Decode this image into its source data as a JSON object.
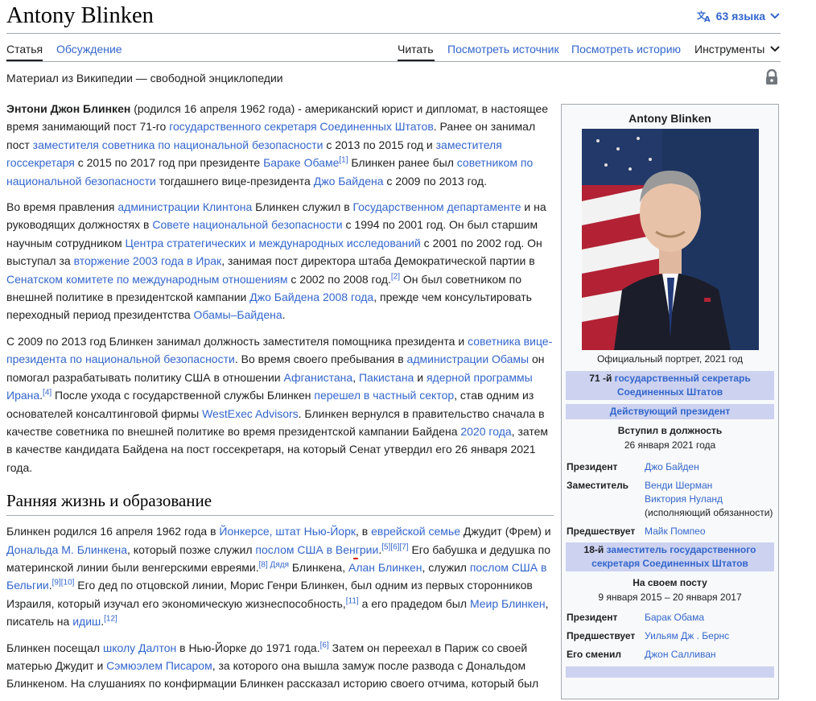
{
  "page": {
    "title": "Antony Blinken",
    "lang_label": "63 языка",
    "tabs": {
      "article": "Статья",
      "talk": "Обсуждение",
      "read": "Читать",
      "view_source": "Посмотреть источник",
      "history": "Посмотреть историю",
      "tools": "Инструменты"
    },
    "tagline": "Материал из Википедии — свободной энциклопедии"
  },
  "article": {
    "p1": {
      "bold": "Энтони Джон Блинкен",
      "t1": " (родился 16 апреля 1962 года) - американский юрист и дипломат, в настоящее время занимающий пост 71-го ",
      "l1": "государственного секретаря Соединенных Штатов",
      "t2": ". Ранее он занимал пост ",
      "l2": "заместителя советника по национальной безопасности",
      "t3": " с 2013 по 2015 год и ",
      "l3": "заместителя госсекретаря",
      "t4": " с 2015 по 2017 год при президенте ",
      "l4": "Бараке Обаме",
      "r1": "[1]",
      "t5": " Блинкен ранее был ",
      "l5": "советником по национальной безопасности",
      "t6": " тогдашнего вице-президента ",
      "l6": "Джо Байдена",
      "t7": " с 2009 по 2013 год."
    },
    "p2": {
      "t1": "Во время правления ",
      "l1": "администрации Клинтона",
      "t2": " Блинкен служил в ",
      "l2": "Государственном департаменте",
      "t3": " и на руководящих должностях в ",
      "l3": "Совете национальной безопасности",
      "t4": " с 1994 по 2001 год. Он был старшим научным сотрудником ",
      "l4": "Центра стратегических и международных исследований",
      "t5": " с 2001 по 2002 год. Он выступал за ",
      "l5": "вторжение 2003 года в Ирак",
      "t6": ", занимая пост директора штаба Демократической партии в ",
      "l6": "Сенатском комитете по международным отношениям",
      "t7": " с 2002 по 2008 год.",
      "r1": "[2]",
      "t8": " Он был советником по внешней политике в президентской кампании ",
      "l7": "Джо Байдена 2008 года",
      "t9": ", прежде чем консультировать переходный период президентства ",
      "l8": "Обамы–Байдена",
      "t10": "."
    },
    "p3": {
      "t1": "С 2009 по 2013 год Блинкен занимал должность заместителя помощника президента и ",
      "l1": "советника вице-президента по национальной безопасности",
      "t2": ". Во время своего пребывания в ",
      "l2": "администрации Обамы",
      "t3": " он помогал разрабатывать политику США в отношении ",
      "l3": "Афганистана",
      "t4": ", ",
      "l4": "Пакистана",
      "t5": " и ",
      "l5": "ядерной программы Ирана",
      "t6": ".",
      "r1": "[4]",
      "t7": " После ухода с государственной службы Блинкен ",
      "l6": "перешел в частный сектор",
      "t8": ", став одним из основателей консалтинговой фирмы ",
      "l7": "WestExec Advisors",
      "t9": ". Блинкен вернулся в правительство сначала в качестве советника по внешней политике во время президентской кампании Байдена ",
      "l8": "2020 года",
      "t10": ", затем в качестве кандидата Байдена на пост госсекретаря, на который Сенат утвердил его 26 января 2021 года."
    },
    "section_heading": "Ранняя жизнь и образование",
    "p4": {
      "t1": "Блинкен родился 16 апреля 1962 года в ",
      "l1": "Йонкерсе, штат Нью-Йорк",
      "t2": ", в ",
      "l2": "еврейской семье",
      "t3": " Джудит (Фрем) и ",
      "l3": "Дональда М. Блинкена",
      "t4": ", который позже служил ",
      "l4": "послом США в Венгрии",
      "t5": ".",
      "r1": "[5][6][7]",
      "t6": " Его бабушка и дедушка по материнской линии были венгерскими евреями.",
      "r2": "[8]",
      "r3": "Дядя",
      "t7": " Блинкена, ",
      "l5": "Алан Блинкен",
      "t8": ", служил ",
      "l6": "послом США в Бельгии",
      "t9": ".",
      "r4": "[9][10]",
      "t10": " Его дед по отцовской линии, Морис Генри Блинкен, был одним из первых сторонников Израиля, который изучал его экономическую жизнеспособность,",
      "r5": "[11]",
      "t11": " а его прадедом был ",
      "l7": "Меир Блинкен",
      "t12": ", писатель на ",
      "l8": "идиш",
      "t13": ".",
      "r6": "[12]"
    },
    "p5": {
      "t1": "Блинкен посещал ",
      "l1": "школу Далтон",
      "t2": " в Нью-Йорке до 1971 года.",
      "r1": "[6]",
      "t3": " Затем он переехал в Париж со своей матерью Джудит и ",
      "l2": "Сэмюэлем Писаром",
      "t4": ", за которого она вышла замуж после развода с Дональдом Блинкеном. На слушаниях по конфирмации Блинкен рассказал историю своего отчима, который был"
    }
  },
  "infobox": {
    "name": "Antony Blinken",
    "caption": "Официальный портрет, 2021 год",
    "bar1_prefix": "71 -й",
    "bar1_link": "государственный секретарь Соединенных Штатов",
    "bar2": "Действующий президент",
    "assumed_label": "Вступил в должность",
    "assumed_date": "26 января 2021 года",
    "rows1": [
      {
        "k": "Президент",
        "v": "Джо Байден",
        "link": true
      },
      {
        "k": "Заместитель",
        "v": "Венди Шерман",
        "link": true
      },
      {
        "k": "",
        "v": "Виктория Нуланд",
        "link": true
      },
      {
        "k": "",
        "v": "(исполняющий обязанности)",
        "link": false
      },
      {
        "k": "Предшествует",
        "v": "Майк Помпео",
        "link": true
      }
    ],
    "bar3_prefix": "18-й",
    "bar3_link": "заместитель государственного секретаря Соединенных Штатов",
    "post_label": "На своем посту",
    "post_dates": "9 января 2015 – 20 января 2017",
    "rows2": [
      {
        "k": "Президент",
        "v": "Барак Обама"
      },
      {
        "k": "Предшествует",
        "v": "Уильям Дж . Бернс"
      },
      {
        "k": "Его сменил",
        "v": "Джон Салливан"
      }
    ]
  },
  "colors": {
    "link": "#3366cc",
    "bar": "#ccd2f0",
    "border": "#a2a9b1",
    "underline": "#d40000"
  }
}
